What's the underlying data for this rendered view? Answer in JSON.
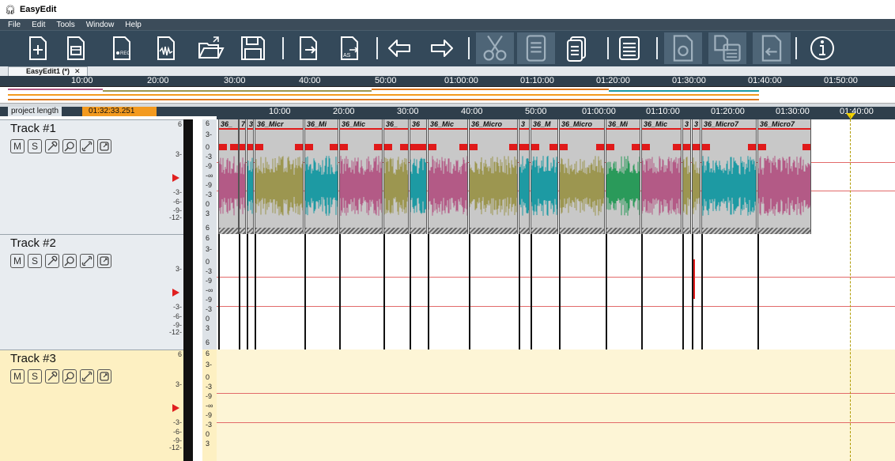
{
  "app": {
    "title": "EasyEdit"
  },
  "menu": [
    "File",
    "Edit",
    "Tools",
    "Window",
    "Help"
  ],
  "toolbar": {
    "buttons": [
      {
        "name": "new-project-button",
        "icon": "file-plus-icon"
      },
      {
        "name": "new-from-template-button",
        "icon": "file-template-icon"
      },
      {
        "name": "record-button",
        "icon": "file-rec-icon",
        "text": "●REC"
      },
      {
        "name": "import-audio-button",
        "icon": "file-wave-icon"
      },
      {
        "name": "open-button",
        "icon": "folder-open-icon"
      },
      {
        "name": "save-button",
        "icon": "floppy-icon"
      },
      {
        "name": "export-button",
        "icon": "file-export-icon"
      },
      {
        "name": "save-as-button",
        "icon": "file-save-as-icon",
        "text": "AS"
      },
      {
        "name": "undo-button",
        "icon": "undo-icon"
      },
      {
        "name": "redo-button",
        "icon": "redo-icon"
      },
      {
        "name": "cut-button",
        "icon": "scissors-icon"
      },
      {
        "name": "copy-button",
        "icon": "copy-icon"
      },
      {
        "name": "paste-button",
        "icon": "paste-icon"
      },
      {
        "name": "clip-list-button",
        "icon": "list-icon"
      },
      {
        "name": "loop-button",
        "icon": "file-loop-icon"
      },
      {
        "name": "paste-overlap-button",
        "icon": "file-stack-icon"
      },
      {
        "name": "import-clip-button",
        "icon": "file-import-icon"
      },
      {
        "name": "info-button",
        "icon": "info-icon"
      }
    ]
  },
  "tabs": [
    {
      "label": "EasyEdit1 (*)",
      "close": "✕"
    }
  ],
  "overview_ruler": [
    "10:00",
    "20:00",
    "30:00",
    "40:00",
    "50:00",
    "01:00:00",
    "01:10:00",
    "01:20:00",
    "01:30:00",
    "01:40:00",
    "01:50:00"
  ],
  "project": {
    "length_label": "project length",
    "length_value": "01:32:33.251"
  },
  "timeline": [
    "10:00",
    "20:00",
    "30:00",
    "40:00",
    "50:00",
    "01:00:00",
    "01:10:00",
    "01:20:00",
    "01:30:00",
    "01:40:00"
  ],
  "tracks": [
    {
      "title": "Track #1",
      "buttons": [
        "M",
        "S"
      ]
    },
    {
      "title": "Track #2",
      "buttons": [
        "M",
        "S"
      ]
    },
    {
      "title": "Track #3",
      "buttons": [
        "M",
        "S"
      ]
    }
  ],
  "track_button_icons": [
    "microphone-icon",
    "search-icon",
    "link-icon",
    "clip-edit-icon"
  ],
  "vu_labels": [
    "6",
    "3-",
    "-3-",
    "-6-",
    "-9-",
    "-12-"
  ],
  "db_labels": [
    "6",
    "3-",
    "0",
    "-3",
    "-9",
    "-∞",
    "-9",
    "-3",
    "0",
    "3",
    "6"
  ],
  "clips": [
    {
      "label": "36_",
      "color": "#b35a86"
    },
    {
      "label": "7",
      "color": "#b35a86"
    },
    {
      "label": "3",
      "color": "#1d9aa3"
    },
    {
      "label": "36_Micr",
      "color": "#9c9650"
    },
    {
      "label": "36_Mi",
      "color": "#1d9aa3"
    },
    {
      "label": "36_Mic",
      "color": "#b35a86"
    },
    {
      "label": "36_",
      "color": "#9c9650"
    },
    {
      "label": "36",
      "color": "#1d9aa3"
    },
    {
      "label": "36_Mic",
      "color": "#b35a86"
    },
    {
      "label": "36_Micro",
      "color": "#9c9650"
    },
    {
      "label": "3",
      "color": "#1d9aa3"
    },
    {
      "label": "36_M",
      "color": "#1d9aa3"
    },
    {
      "label": "36_Micro",
      "color": "#9c9650"
    },
    {
      "label": "36_Mi",
      "color": "#2a9a5a"
    },
    {
      "label": "36_Mic",
      "color": "#b35a86"
    },
    {
      "label": "3",
      "color": "#9c9650"
    },
    {
      "label": "3",
      "color": "#9c9650"
    },
    {
      "label": "36_Micro7",
      "color": "#1d9aa3"
    },
    {
      "label": "36_Micro7",
      "color": "#b35a86"
    }
  ],
  "colors": {
    "toolbar_bg": "#34495a",
    "menubar_bg": "#3c4c5a",
    "accent_orange": "#f39a1f",
    "fade_red": "#e01a1a",
    "playhead_yellow": "#f0d000"
  }
}
